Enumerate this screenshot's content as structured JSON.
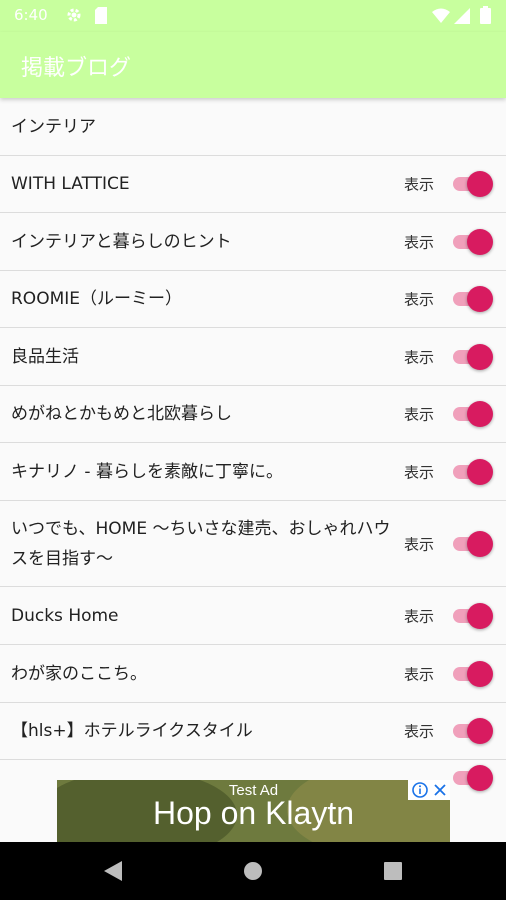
{
  "status_bar": {
    "time": "6:40"
  },
  "app_bar": {
    "title": "掲載ブログ"
  },
  "list": {
    "header": "インテリア",
    "show_label": "表示",
    "items": [
      {
        "name": "WITH LATTICE",
        "enabled": true
      },
      {
        "name": "インテリアと暮らしのヒント",
        "enabled": true
      },
      {
        "name": "ROOMIE（ルーミー）",
        "enabled": true
      },
      {
        "name": "良品生活",
        "enabled": true
      },
      {
        "name": "めがねとかもめと北欧暮らし",
        "enabled": true
      },
      {
        "name": "キナリノ - 暮らしを素敵に丁寧に。",
        "enabled": true
      },
      {
        "name": "いつでも、HOME 〜ちいさな建売、おしゃれハウスを目指す〜",
        "enabled": true
      },
      {
        "name": "Ducks Home",
        "enabled": true
      },
      {
        "name": "わが家のここち。",
        "enabled": true
      },
      {
        "name": "【hls+】ホテルライクスタイル",
        "enabled": true
      }
    ]
  },
  "ad": {
    "label": "Test Ad",
    "headline": "Hop on Klaytn"
  },
  "colors": {
    "app_bar": "#c8ff9e",
    "switch_thumb": "#d81b60",
    "switch_track": "#f0a0bb"
  }
}
